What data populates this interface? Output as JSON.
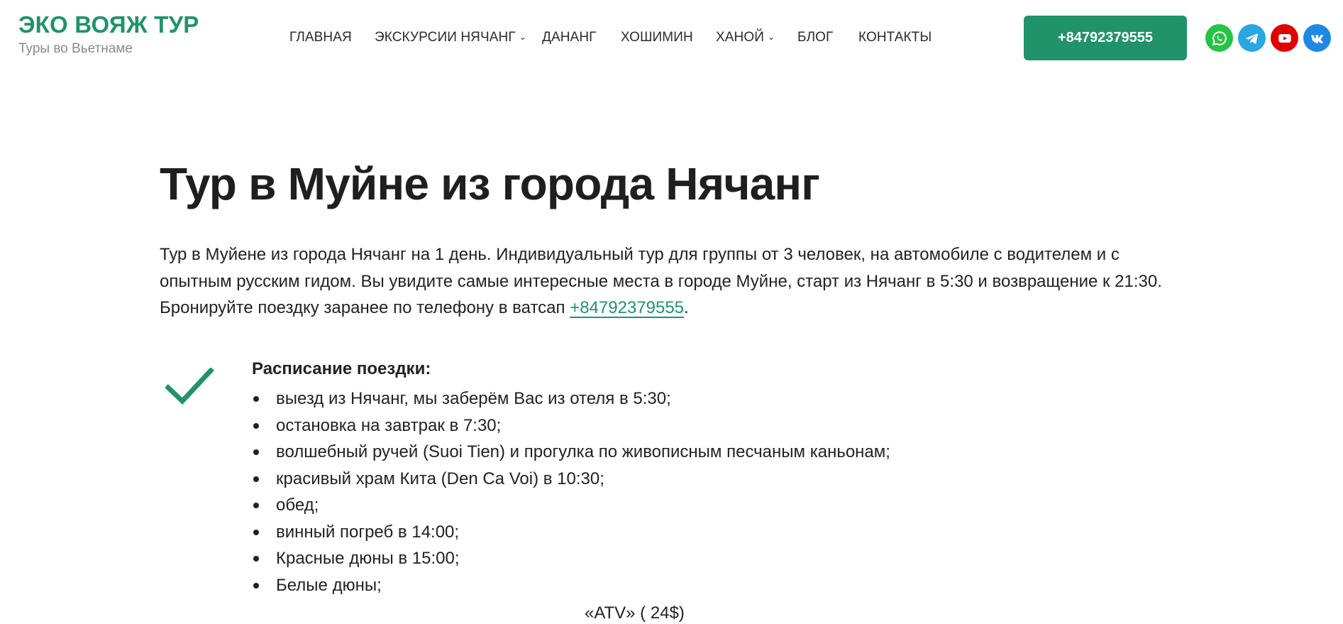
{
  "header": {
    "logo_title": "ЭКО ВОЯЖ ТУР",
    "logo_subtitle": "Туры во Вьетнаме",
    "nav": [
      {
        "label": "ГЛАВНАЯ",
        "has_dropdown": false
      },
      {
        "label": "ЭКСКУРСИИ НЯЧАНГ",
        "has_dropdown": true
      },
      {
        "label": "ДАНАНГ",
        "has_dropdown": false
      },
      {
        "label": "ХОШИМИН",
        "has_dropdown": false
      },
      {
        "label": "ХАНОЙ",
        "has_dropdown": true
      },
      {
        "label": "БЛОГ",
        "has_dropdown": false
      },
      {
        "label": "КОНТАКТЫ",
        "has_dropdown": false
      }
    ],
    "dropdown_caret": "⌄",
    "phone_button": "+84792379555",
    "social": [
      {
        "icon": "whatsapp-icon",
        "color": "#25c444"
      },
      {
        "icon": "telegram-icon",
        "color": "#2aa6e0"
      },
      {
        "icon": "youtube-icon",
        "color": "#e00000"
      },
      {
        "icon": "vk-icon",
        "color": "#1e88e5"
      }
    ]
  },
  "main": {
    "title": "Тур в Муйне из города Нячанг",
    "intro_text": "Тур в Муйене из города Нячанг на 1 день. Индивидуальный тур для группы от 3 человек, на автомобиле с водителем и с опытным русским гидом. Вы увидите самые интересные места в городе Муйне, старт из Нячанг в 5:30 и возвращение к 21:30. Бронируйте поездку заранее по телефону в ватсап ",
    "intro_phone": "+84792379555",
    "intro_end": ".",
    "schedule_title": "Расписание поездки:",
    "schedule_items": [
      "выезд из Нячанг, мы заберём Вас из отеля в 5:30;",
      "остановка на завтрак в 7:30;",
      "волшебный ручей (Suoi Tien) и прогулка по живописным песчаным каньонам;",
      "красивый храм Кита (Den Ca Voi) в 10:30;",
      "обед;",
      "винный погреб в 14:00;",
      "Красные дюны в 15:00;",
      "Белые дюны;"
    ],
    "cut_off_line": "«АТV» (                                        24$)"
  },
  "colors": {
    "accent": "#20936b",
    "text": "#222222",
    "muted": "#8a8a8a"
  }
}
